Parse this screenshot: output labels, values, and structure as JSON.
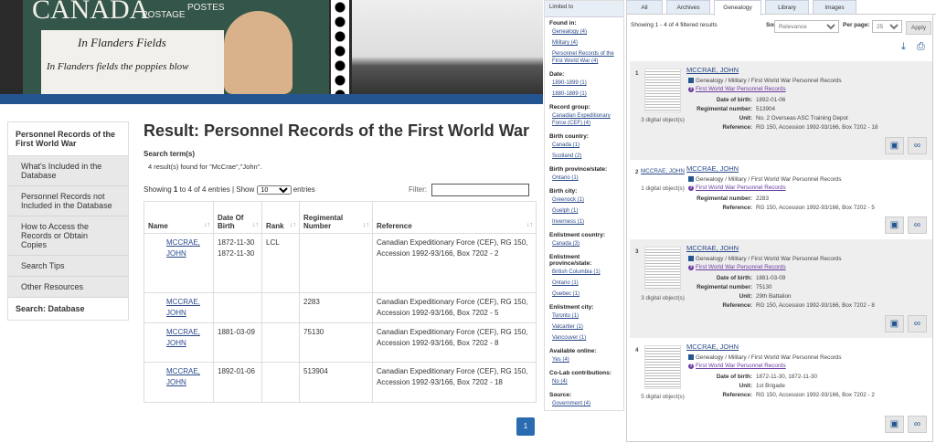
{
  "banner": {
    "stamp_country": "CANADA",
    "stamp_postage": "POSTAGE",
    "stamp_postes": "POSTES",
    "poem_title": "In Flanders Fields",
    "poem_line": "In Flanders fields the poppies blow"
  },
  "sidebar": {
    "title": "Personnel Records of the First World War",
    "items": [
      {
        "label": "What's Included in the Database"
      },
      {
        "label": "Personnel Records not Included in the Database"
      },
      {
        "label": "How to Access the Records or Obtain Copies"
      },
      {
        "label": "Search Tips"
      },
      {
        "label": "Other Resources"
      }
    ],
    "active": "Search: Database"
  },
  "main": {
    "title": "Result: Personnel Records of the First World War",
    "search_terms_label": "Search term(s)",
    "results_text": "4 result(s) found for \"McCrae\",\"John\".",
    "showing_pre": "Showing ",
    "showing_from": "1",
    "showing_mid": " to 4 of 4 entries | Show ",
    "show_value": "10",
    "entries": " entries",
    "filter_label": "Filter:",
    "filter_value": "",
    "columns": [
      "Name",
      "Date Of Birth",
      "Rank",
      "Regimental Number",
      "Reference"
    ],
    "rows": [
      {
        "name": "MCCRAE, JOHN",
        "dob": "1872-11-30 1872-11-30",
        "rank": "LCL",
        "reg": "",
        "ref": "Canadian Expeditionary Force (CEF), RG 150, Accession 1992-93/166, Box 7202 - 2"
      },
      {
        "name": "MCCRAE, JOHN",
        "dob": "",
        "rank": "",
        "reg": "2283",
        "ref": "Canadian Expeditionary Force (CEF), RG 150, Accession 1992-93/166, Box 7202 - 5"
      },
      {
        "name": "MCCRAE, JOHN",
        "dob": "1881-03-09",
        "rank": "",
        "reg": "75130",
        "ref": "Canadian Expeditionary Force (CEF), RG 150, Accession 1992-93/166, Box 7202 - 8"
      },
      {
        "name": "MCCRAE, JOHN",
        "dob": "1892-01-06",
        "rank": "",
        "reg": "513904",
        "ref": "Canadian Expeditionary Force (CEF), RG 150, Accession 1992-93/166, Box 7202 - 18"
      }
    ],
    "page": "1"
  },
  "filters": {
    "title": "Limited to",
    "groups": [
      {
        "label": "Found in:",
        "items": [
          "Genealogy (4)",
          "Military (4)",
          "Personnel Records of the First World War (4)"
        ]
      },
      {
        "label": "Date:",
        "items": [
          "1890-1899 (1)",
          "1880-1889 (1)"
        ]
      },
      {
        "label": "Record group:",
        "items": [
          "Canadian Expeditionary Force (CEF) (4)"
        ]
      },
      {
        "label": "Birth country:",
        "items": [
          "Canada (1)",
          "Scotland (2)"
        ]
      },
      {
        "label": "Birth province/state:",
        "items": [
          "Ontario (1)"
        ]
      },
      {
        "label": "Birth city:",
        "items": [
          "Greenock (1)",
          "Guelph (1)",
          "Inverness (1)"
        ]
      },
      {
        "label": "Enlistment country:",
        "items": [
          "Canada (3)"
        ]
      },
      {
        "label": "Enlistment province/state:",
        "items": [
          "British Columbia (1)",
          "Ontario (1)",
          "Quebec (1)"
        ]
      },
      {
        "label": "Enlistment city:",
        "items": [
          "Toronto (1)",
          "Valcartier (1)",
          "Vancouver (1)"
        ]
      },
      {
        "label": "Available online:",
        "items": [
          "Yes (4)"
        ]
      },
      {
        "label": "Co-Lab contributions:",
        "items": [
          "No (4)"
        ]
      },
      {
        "label": "Source:",
        "items": [
          "Government (4)"
        ]
      }
    ]
  },
  "results": {
    "tabs": [
      "All",
      "Archives",
      "Genealogy",
      "Library",
      "Images"
    ],
    "active_tab": "Genealogy",
    "showing": "Showing 1 - 4 of 4 filtered results",
    "sort_label": "Sort by:",
    "sort_value": "Relevance",
    "per_page_label": "Per page:",
    "per_page_value": "25",
    "apply": "Apply",
    "items": [
      {
        "num": "1",
        "title": "MCCRAE, JOHN",
        "path": "Genealogy / Military / First World War Personnel Records",
        "link": "First World War Personnel Records",
        "objects": "3 digital object(s)",
        "fields": [
          [
            "Date of birth:",
            "1892-01-06"
          ],
          [
            "Regimental number:",
            "513904"
          ],
          [
            "Unit:",
            "No. 2 Overseas ASC Training Depot"
          ],
          [
            "Reference:",
            "RG 150, Accession 1992-93/166, Box 7202 - 18"
          ]
        ]
      },
      {
        "num": "2",
        "title": "MCCRAE, JOHN",
        "thumb_alt": "MCCRAE, JOHN",
        "path": "Genealogy / Military / First World War Personnel Records",
        "link": "First World War Personnel Records",
        "objects": "1 digital object(s)",
        "fields": [
          [
            "Regimental number:",
            "2283"
          ],
          [
            "Reference:",
            "RG 150, Accession 1992-93/166, Box 7202 - 5"
          ]
        ]
      },
      {
        "num": "3",
        "title": "MCCRAE, JOHN",
        "path": "Genealogy / Military / First World War Personnel Records",
        "link": "First World War Personnel Records",
        "objects": "3 digital object(s)",
        "fields": [
          [
            "Date of birth:",
            "1881-03-09"
          ],
          [
            "Regimental number:",
            "75130"
          ],
          [
            "Unit:",
            "29th Battalion"
          ],
          [
            "Reference:",
            "RG 150, Accession 1992-93/166, Box 7202 - 8"
          ]
        ]
      },
      {
        "num": "4",
        "title": "MCCRAE, JOHN",
        "path": "Genealogy / Military / First World War Personnel Records",
        "link": "First World War Personnel Records",
        "objects": "5 digital object(s)",
        "fields": [
          [
            "Date of birth:",
            "1872-11-30, 1872-11-30"
          ],
          [
            "Unit:",
            "1st Brigade"
          ],
          [
            "Reference:",
            "RG 150, Accession 1992-93/166, Box 7202 - 2"
          ]
        ]
      }
    ]
  }
}
